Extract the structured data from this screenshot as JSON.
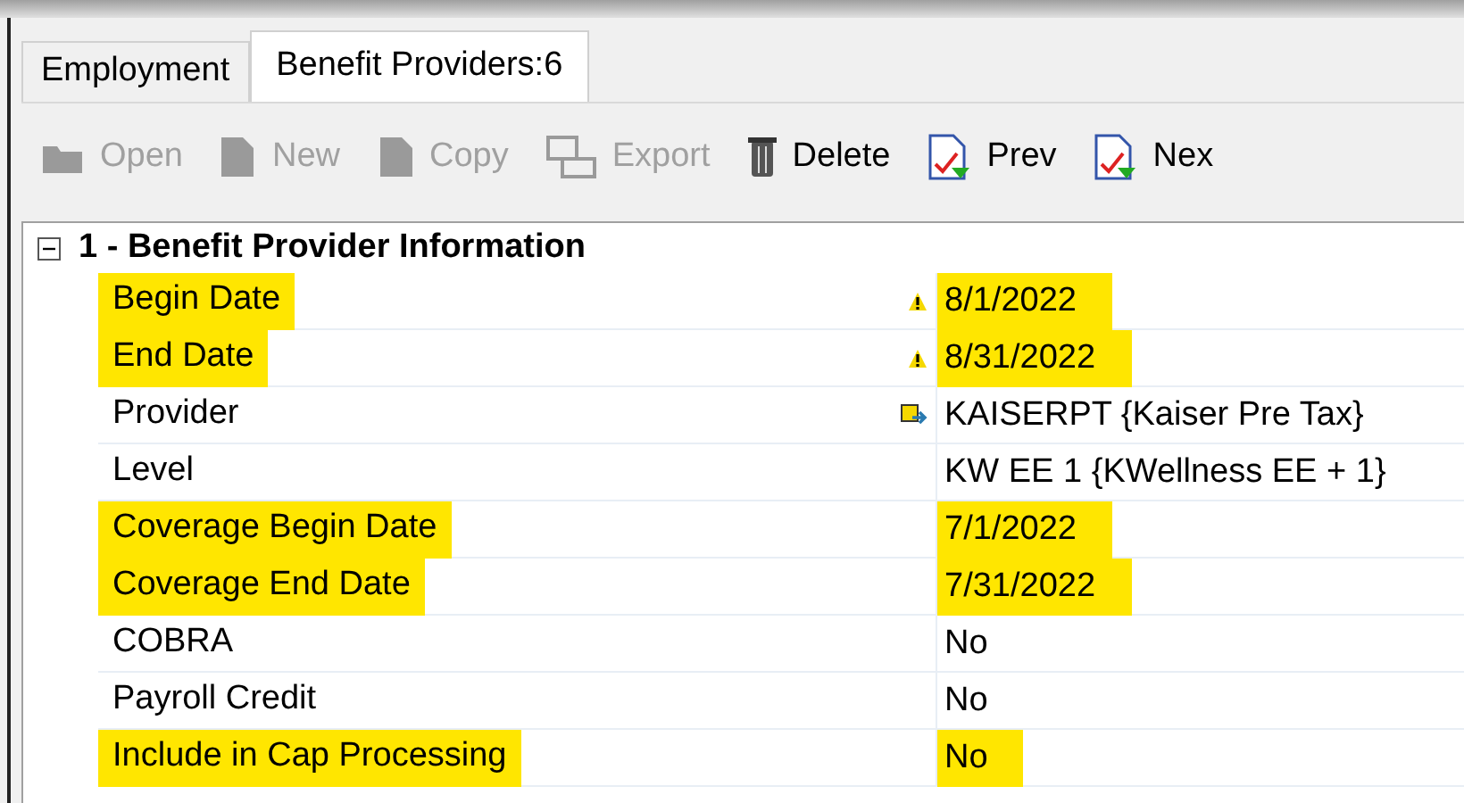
{
  "tabs": [
    {
      "label": "Employment",
      "selected": false
    },
    {
      "label": "Benefit Providers:6",
      "selected": true
    }
  ],
  "toolbar": [
    {
      "label": "Open",
      "kind": "open",
      "disabled": true
    },
    {
      "label": "New",
      "kind": "new",
      "disabled": true
    },
    {
      "label": "Copy",
      "kind": "copy",
      "disabled": true
    },
    {
      "label": "Export",
      "kind": "export",
      "disabled": true
    },
    {
      "label": "Delete",
      "kind": "delete",
      "disabled": false
    },
    {
      "label": "Prev",
      "kind": "prev",
      "disabled": false
    },
    {
      "label": "Nex",
      "kind": "next",
      "disabled": false
    }
  ],
  "section": {
    "title": "1 - Benefit Provider Information",
    "expanded": true
  },
  "rows": [
    {
      "label": "Begin Date",
      "value": "8/1/2022",
      "kind": "warning",
      "highlighted": true
    },
    {
      "label": "End Date",
      "value": "8/31/2022",
      "kind": "warning",
      "highlighted": true
    },
    {
      "label": "Provider",
      "value": "KAISERPT {Kaiser Pre Tax}",
      "kind": "lookup",
      "highlighted": false
    },
    {
      "label": "Level",
      "value": "KW EE 1 {KWellness EE + 1}",
      "highlighted": false
    },
    {
      "label": "Coverage Begin Date",
      "value": "7/1/2022",
      "highlighted": true
    },
    {
      "label": "Coverage End Date",
      "value": "7/31/2022",
      "highlighted": true
    },
    {
      "label": "COBRA",
      "value": "No",
      "highlighted": false
    },
    {
      "label": "Payroll Credit",
      "value": "No",
      "highlighted": false
    },
    {
      "label": "Include in Cap Processing",
      "value": "No",
      "highlighted": true
    }
  ]
}
